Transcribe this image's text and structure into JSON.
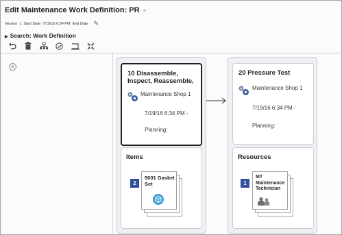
{
  "header": {
    "title": "Edit Maintenance Work Definition: PR",
    "version_label": "Version",
    "version_value": "1",
    "start_label": "Start Date",
    "start_value": "7/19/16 6:34 PM",
    "end_label": "End Date"
  },
  "search": {
    "label": "Search: Work Definition"
  },
  "toolbar": {
    "icons": [
      "undo-icon",
      "delete-icon",
      "structure-icon",
      "check-icon",
      "frame-icon",
      "collapse-icon"
    ]
  },
  "operations": [
    {
      "title": "10 Disassemble, Inspect, Reassemble,",
      "shop": "Maintenance Shop 1",
      "date": "7/19/16 6:34 PM -",
      "status": "Planning:"
    },
    {
      "title": "20 Pressure Test",
      "shop": "Maintenance Shop 1",
      "date": "7/19/16 6:34 PM -",
      "status": "Planning:"
    }
  ],
  "items": {
    "title": "Items",
    "count": "2",
    "label": "5001 Gasket Set"
  },
  "resources": {
    "title": "Resources",
    "count": "1",
    "label": "MT Maintenance Technician"
  },
  "colors": {
    "badge": "#2f4f9a",
    "selected_border": "#1f1f1f",
    "cube": "#3ea0da"
  }
}
